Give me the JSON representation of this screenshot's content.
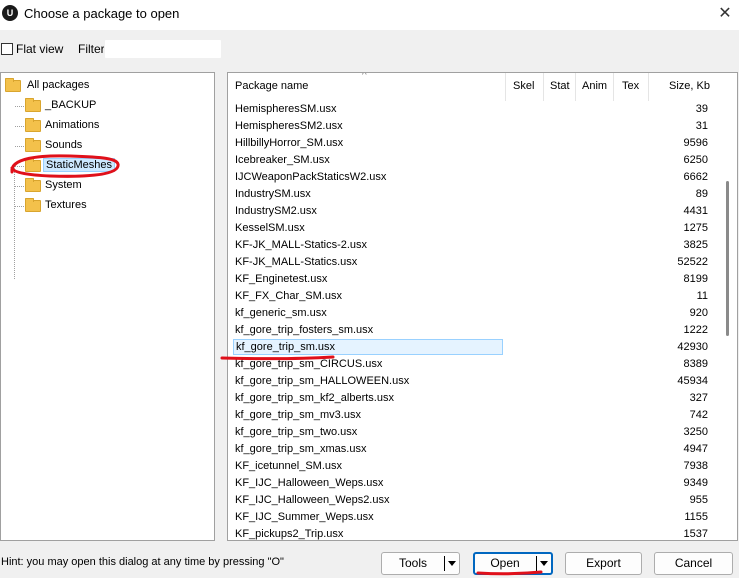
{
  "window": {
    "title": "Choose a package to open",
    "app_icon": "unreal-engine-logo-icon",
    "close_glyph": "✕"
  },
  "filter": {
    "flat_view_label": "Flat view",
    "flat_view_checked": false,
    "filter_label": "Filter:",
    "filter_value": ""
  },
  "tree": {
    "root": "All packages",
    "items": [
      {
        "label": "_BACKUP",
        "selected": false
      },
      {
        "label": "Animations",
        "selected": false
      },
      {
        "label": "Sounds",
        "selected": false
      },
      {
        "label": "StaticMeshes",
        "selected": true
      },
      {
        "label": "System",
        "selected": false
      },
      {
        "label": "Textures",
        "selected": false
      }
    ]
  },
  "list": {
    "columns": [
      "Package name",
      "Skel",
      "Stat",
      "Anim",
      "Tex",
      "Size, Kb"
    ],
    "rows": [
      {
        "name": "HemispheresSM.usx",
        "size": "39"
      },
      {
        "name": "HemispheresSM2.usx",
        "size": "31"
      },
      {
        "name": "HillbillyHorror_SM.usx",
        "size": "9596"
      },
      {
        "name": "Icebreaker_SM.usx",
        "size": "6250"
      },
      {
        "name": "IJCWeaponPackStaticsW2.usx",
        "size": "6662"
      },
      {
        "name": "IndustrySM.usx",
        "size": "89"
      },
      {
        "name": "IndustrySM2.usx",
        "size": "4431"
      },
      {
        "name": "KesselSM.usx",
        "size": "1275"
      },
      {
        "name": "KF-JK_MALL-Statics-2.usx",
        "size": "3825"
      },
      {
        "name": "KF-JK_MALL-Statics.usx",
        "size": "52522"
      },
      {
        "name": "KF_Enginetest.usx",
        "size": "8199"
      },
      {
        "name": "KF_FX_Char_SM.usx",
        "size": "11"
      },
      {
        "name": "kf_generic_sm.usx",
        "size": "920"
      },
      {
        "name": "kf_gore_trip_fosters_sm.usx",
        "size": "1222"
      },
      {
        "name": "kf_gore_trip_sm.usx",
        "size": "42930"
      },
      {
        "name": "kf_gore_trip_sm_CIRCUS.usx",
        "size": "8389"
      },
      {
        "name": "kf_gore_trip_sm_HALLOWEEN.usx",
        "size": "45934"
      },
      {
        "name": "kf_gore_trip_sm_kf2_alberts.usx",
        "size": "327"
      },
      {
        "name": "kf_gore_trip_sm_mv3.usx",
        "size": "742"
      },
      {
        "name": "kf_gore_trip_sm_two.usx",
        "size": "3250"
      },
      {
        "name": "kf_gore_trip_sm_xmas.usx",
        "size": "4947"
      },
      {
        "name": "KF_icetunnel_SM.usx",
        "size": "7938"
      },
      {
        "name": "KF_IJC_Halloween_Weps.usx",
        "size": "9349"
      },
      {
        "name": "KF_IJC_Halloween_Weps2.usx",
        "size": "955"
      },
      {
        "name": "KF_IJC_Summer_Weps.usx",
        "size": "1155"
      },
      {
        "name": "KF_pickups2_Trip.usx",
        "size": "1537"
      }
    ],
    "selected_row": "kf_gore_trip_sm.usx"
  },
  "footer": {
    "hint": "Hint: you may open this dialog at any time by pressing \"O\"",
    "tools_label": "Tools",
    "open_label": "Open",
    "export_label": "Export",
    "cancel_label": "Cancel"
  },
  "colors": {
    "selection_highlight": "#cce8ff",
    "annotation_red": "#e0101a",
    "default_button_border": "#0067c0",
    "folder_yellow": "#f3c14b"
  }
}
